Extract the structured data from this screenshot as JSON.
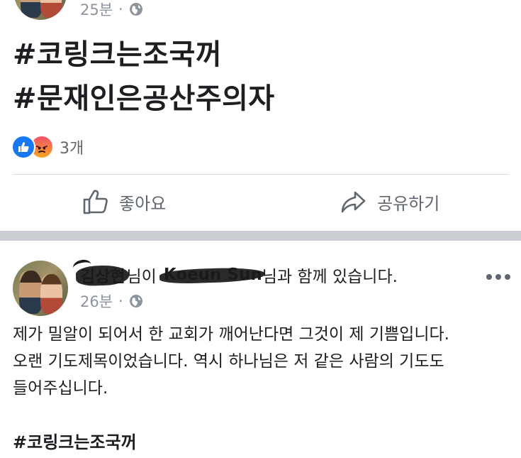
{
  "post_top": {
    "time": "25분",
    "dot": "·",
    "hashtags": [
      "#코링크는조국꺼",
      "#문재인은공산주의자"
    ],
    "reaction_count": "3개",
    "reactions": [
      "like-icon",
      "angry-icon"
    ],
    "actions": {
      "like_label": "좋아요",
      "share_label": "공유하기"
    }
  },
  "post_bottom": {
    "author": "김상현",
    "with_particle": "님이",
    "tagged_user": "Koeun Sun",
    "with_suffix": "님과 함께 있습니다.",
    "time": "26분",
    "dot": "·",
    "body_lines": [
      "제가 밀알이 되어서 한 교회가 깨어난다면 그것이 제 기쁨입니다.",
      "오랜 기도제목이었습니다. 역시 하나님은 저 같은 사람의 기도도",
      "들어주십니다."
    ],
    "hashtag": "#코링크는조국꺼"
  },
  "colors": {
    "accent": "#1877f2",
    "meta_text": "#8d949e",
    "separator": "#c9ccd1"
  }
}
